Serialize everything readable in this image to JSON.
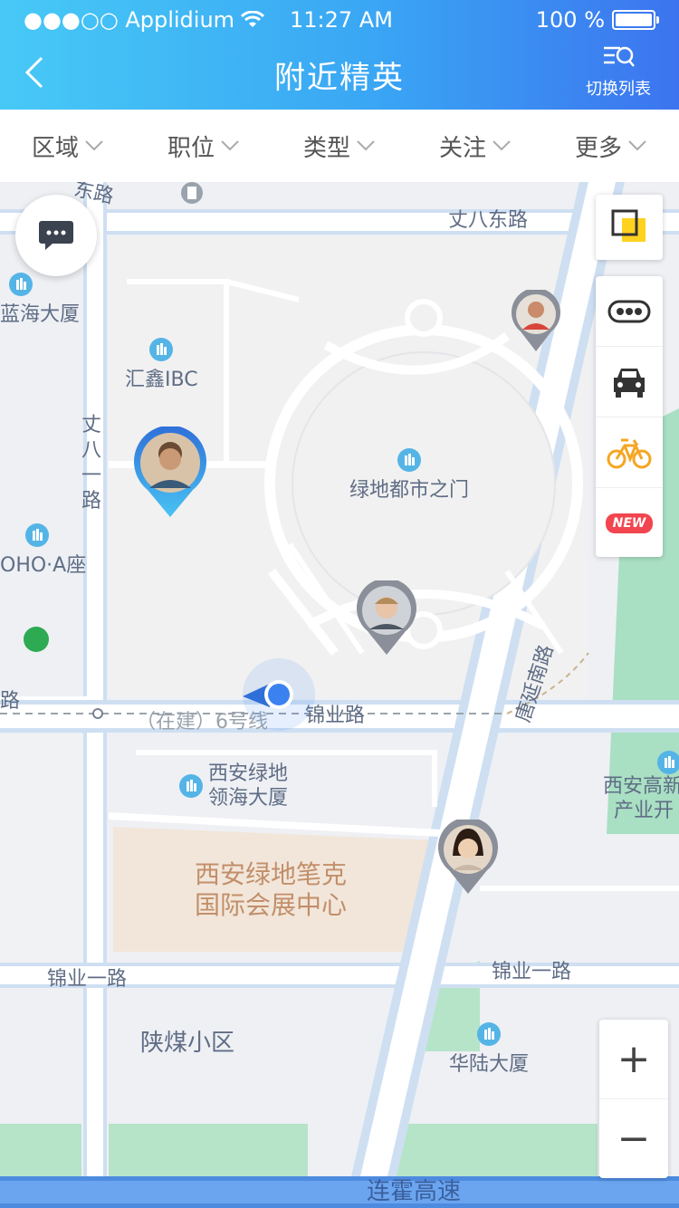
{
  "status_bar": {
    "carrier": "●●●○○ Applidium",
    "time": "11:27 AM",
    "battery": "100 %",
    "battery_level": 1.0
  },
  "header": {
    "title": "附近精英",
    "switch_label": "切换列表"
  },
  "filters": [
    {
      "label": "区域"
    },
    {
      "label": "职位"
    },
    {
      "label": "类型"
    },
    {
      "label": "关注"
    },
    {
      "label": "更多"
    }
  ],
  "map": {
    "roads": {
      "top": "丈八东路",
      "top_partial": "东路",
      "left_vertical": "丈八一路",
      "middle": "锦业路",
      "metro": "（在建）6号线",
      "right_diagonal": "唐延南路",
      "lower": "锦业一路",
      "lower_right": "锦业一路",
      "bottom": "连霍高速",
      "left_partial": "路"
    },
    "pois": {
      "lanhai": "蓝海大厦",
      "huixin": "汇鑫IBC",
      "lvdi_gate": "绿地都市之门",
      "soho": "OHO·A座",
      "lingshai_1": "西安绿地",
      "lingshai_2": "领海大厦",
      "gaoxin_1": "西安高新",
      "gaoxin_2": "产业开",
      "expo_1": "西安绿地笔克",
      "expo_2": "国际会展中心",
      "shanmei": "陕煤小区",
      "hualu": "华陆大厦"
    },
    "tools": {
      "new_badge": "NEW"
    },
    "zoom": {
      "in": "+",
      "out": "−"
    }
  },
  "colors": {
    "header_start": "#47c9f6",
    "header_end": "#3c74ef",
    "pin_active": "#2f8de4",
    "pin_grey": "#8a8f99",
    "road": "#ffffff",
    "road_major": "#bcd3ef",
    "expo_area": "#f2e6da",
    "park": "#a9dfc3"
  }
}
